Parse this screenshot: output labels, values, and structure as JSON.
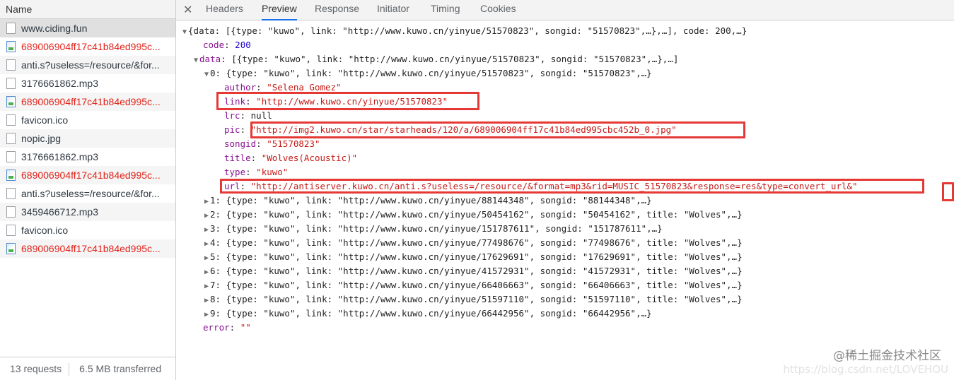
{
  "left_panel": {
    "header": "Name",
    "requests": [
      {
        "name": "www.ciding.fun",
        "type": "doc",
        "error": false,
        "selected": true
      },
      {
        "name": "689006904ff17c41b84ed995c...",
        "type": "img",
        "error": true
      },
      {
        "name": "anti.s?useless=/resource/&for...",
        "type": "doc",
        "error": false
      },
      {
        "name": "3176661862.mp3",
        "type": "doc",
        "error": false
      },
      {
        "name": "689006904ff17c41b84ed995c...",
        "type": "img",
        "error": true
      },
      {
        "name": "favicon.ico",
        "type": "doc",
        "error": false
      },
      {
        "name": "nopic.jpg",
        "type": "doc",
        "error": false
      },
      {
        "name": "3176661862.mp3",
        "type": "doc",
        "error": false
      },
      {
        "name": "689006904ff17c41b84ed995c...",
        "type": "img",
        "error": true
      },
      {
        "name": "anti.s?useless=/resource/&for...",
        "type": "doc",
        "error": false
      },
      {
        "name": "3459466712.mp3",
        "type": "doc",
        "error": false
      },
      {
        "name": "favicon.ico",
        "type": "doc",
        "error": false
      },
      {
        "name": "689006904ff17c41b84ed995c...",
        "type": "img",
        "error": true
      }
    ],
    "status": {
      "requests": "13 requests",
      "transferred": "6.5 MB transferred"
    }
  },
  "tabs": [
    "Headers",
    "Preview",
    "Response",
    "Initiator",
    "Timing",
    "Cookies"
  ],
  "active_tab": "Preview",
  "preview": {
    "root": "{data: [{type: \"kuwo\", link: \"http://www.kuwo.cn/yinyue/51570823\", songid: \"51570823\",…},…], code: 200,…}",
    "code_key": "code",
    "code_val": "200",
    "data_key": "data",
    "data_summary": "[{type: \"kuwo\", link: \"http://www.kuwo.cn/yinyue/51570823\", songid: \"51570823\",…},…]",
    "item0_summary": "0: {type: \"kuwo\", link: \"http://www.kuwo.cn/yinyue/51570823\", songid: \"51570823\",…}",
    "item0": {
      "author": "\"Selena Gomez\"",
      "link": "\"http://www.kuwo.cn/yinyue/51570823\"",
      "lrc": "null",
      "pic": "\"http://img2.kuwo.cn/star/starheads/120/a/689006904ff17c41b84ed995cbc452b_0.jpg\"",
      "songid": "\"51570823\"",
      "title": "\"Wolves(Acoustic)\"",
      "type": "\"kuwo\"",
      "url": "\"http://antiserver.kuwo.cn/anti.s?useless=/resource/&format=mp3&rid=MUSIC_51570823&response=res&type=convert_url&\""
    },
    "items": [
      "1: {type: \"kuwo\", link: \"http://www.kuwo.cn/yinyue/88144348\", songid: \"88144348\",…}",
      "2: {type: \"kuwo\", link: \"http://www.kuwo.cn/yinyue/50454162\", songid: \"50454162\", title: \"Wolves\",…}",
      "3: {type: \"kuwo\", link: \"http://www.kuwo.cn/yinyue/151787611\", songid: \"151787611\",…}",
      "4: {type: \"kuwo\", link: \"http://www.kuwo.cn/yinyue/77498676\", songid: \"77498676\", title: \"Wolves\",…}",
      "5: {type: \"kuwo\", link: \"http://www.kuwo.cn/yinyue/17629691\", songid: \"17629691\", title: \"Wolves\",…}",
      "6: {type: \"kuwo\", link: \"http://www.kuwo.cn/yinyue/41572931\", songid: \"41572931\", title: \"Wolves\",…}",
      "7: {type: \"kuwo\", link: \"http://www.kuwo.cn/yinyue/66406663\", songid: \"66406663\", title: \"Wolves\",…}",
      "8: {type: \"kuwo\", link: \"http://www.kuwo.cn/yinyue/51597110\", songid: \"51597110\", title: \"Wolves\",…}",
      "9: {type: \"kuwo\", link: \"http://www.kuwo.cn/yinyue/66442956\", songid: \"66442956\",…}"
    ],
    "error_key": "error",
    "error_val": "\"\""
  },
  "watermark": "@稀土掘金技术社区",
  "watermark_faint": "https://blog.csdn.net/LOVEHOU"
}
